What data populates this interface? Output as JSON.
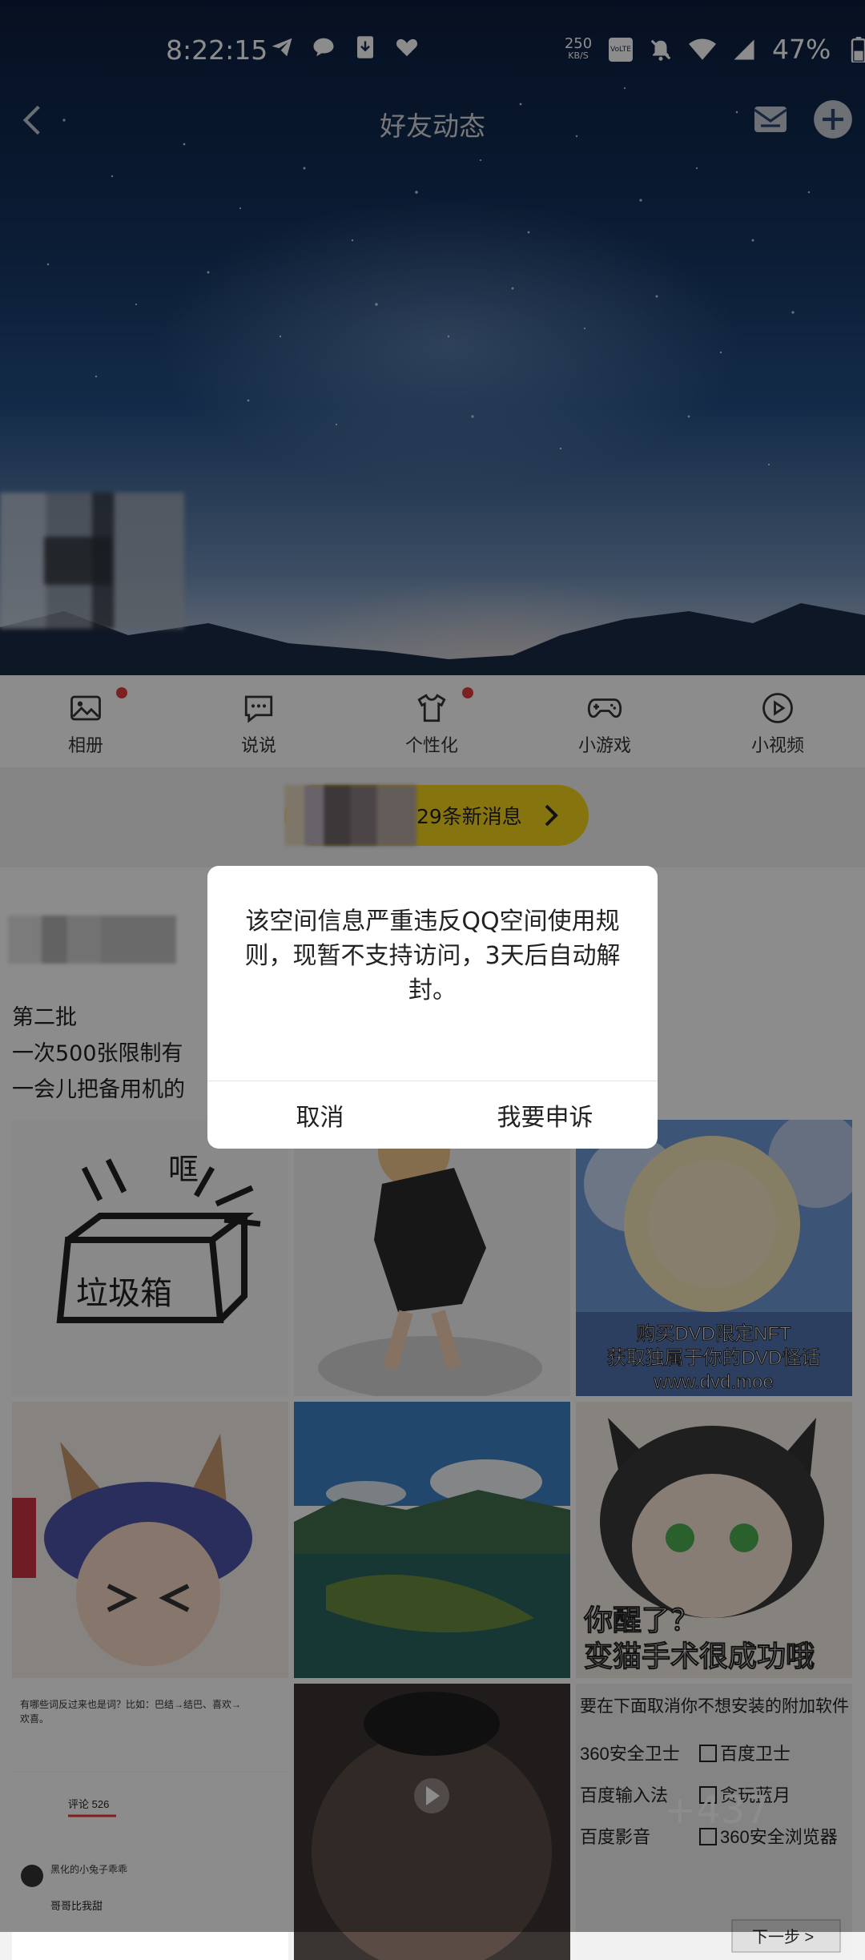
{
  "status_bar": {
    "time": "8:22:15",
    "net_speed_value": "250",
    "net_speed_unit": "KB/S",
    "volte": "VoLTE",
    "battery": "47%",
    "left_icons": [
      "telegram-icon",
      "chat-bubble-icon",
      "download-icon",
      "heart-icon"
    ],
    "right_icons": [
      "mute-icon",
      "wifi-icon",
      "signal-icon",
      "battery-icon"
    ]
  },
  "header": {
    "title": "好友动态",
    "actions": [
      "inbox-icon",
      "add-icon"
    ]
  },
  "tabs": [
    {
      "label": "相册",
      "icon": "photo-album-icon",
      "dot": true
    },
    {
      "label": "说说",
      "icon": "chat-dots-icon",
      "dot": false
    },
    {
      "label": "个性化",
      "icon": "tshirt-icon",
      "dot": true
    },
    {
      "label": "小游戏",
      "icon": "gamepad-icon",
      "dot": false
    },
    {
      "label": "小视频",
      "icon": "play-circle-icon",
      "dot": false
    }
  ],
  "notification": {
    "text": "29条新消息"
  },
  "post": {
    "lines": [
      "第二批",
      "一次500张限制有",
      "一会儿把备用机的"
    ],
    "images": {
      "trash_text": "垃圾箱",
      "trash_sound": "哐",
      "dvd_caption_1": "购买DVD限定NFT",
      "dvd_caption_2": "获取独属于你的DVD怪话",
      "dvd_caption_3": "www.dvd.moe",
      "cat_caption_1": "你醒了？",
      "cat_caption_2": "变猫手术很成功哦",
      "comment_text_1": "有哪些词反过来也是词？比如：巴结→结巴、喜欢→",
      "comment_text_2": "欢喜。",
      "comment_tab": "评论 526",
      "comment_user": "黑化的小兔子乖乖",
      "comment_reply": "哥哥比我甜",
      "installer_header": "要在下面取消你不想安装的附加软件",
      "installer_items": [
        "360安全卫士",
        "百度卫士",
        "百度输入法",
        "贪玩蓝月",
        "百度影音",
        "360安全浏览器"
      ],
      "installer_next": "下一步 >"
    },
    "more_count": "+437"
  },
  "dialog": {
    "message": "该空间信息严重违反QQ空间使用规则，现暂不支持访问，3天后自动解封。",
    "cancel_label": "取消",
    "appeal_label": "我要申诉"
  }
}
